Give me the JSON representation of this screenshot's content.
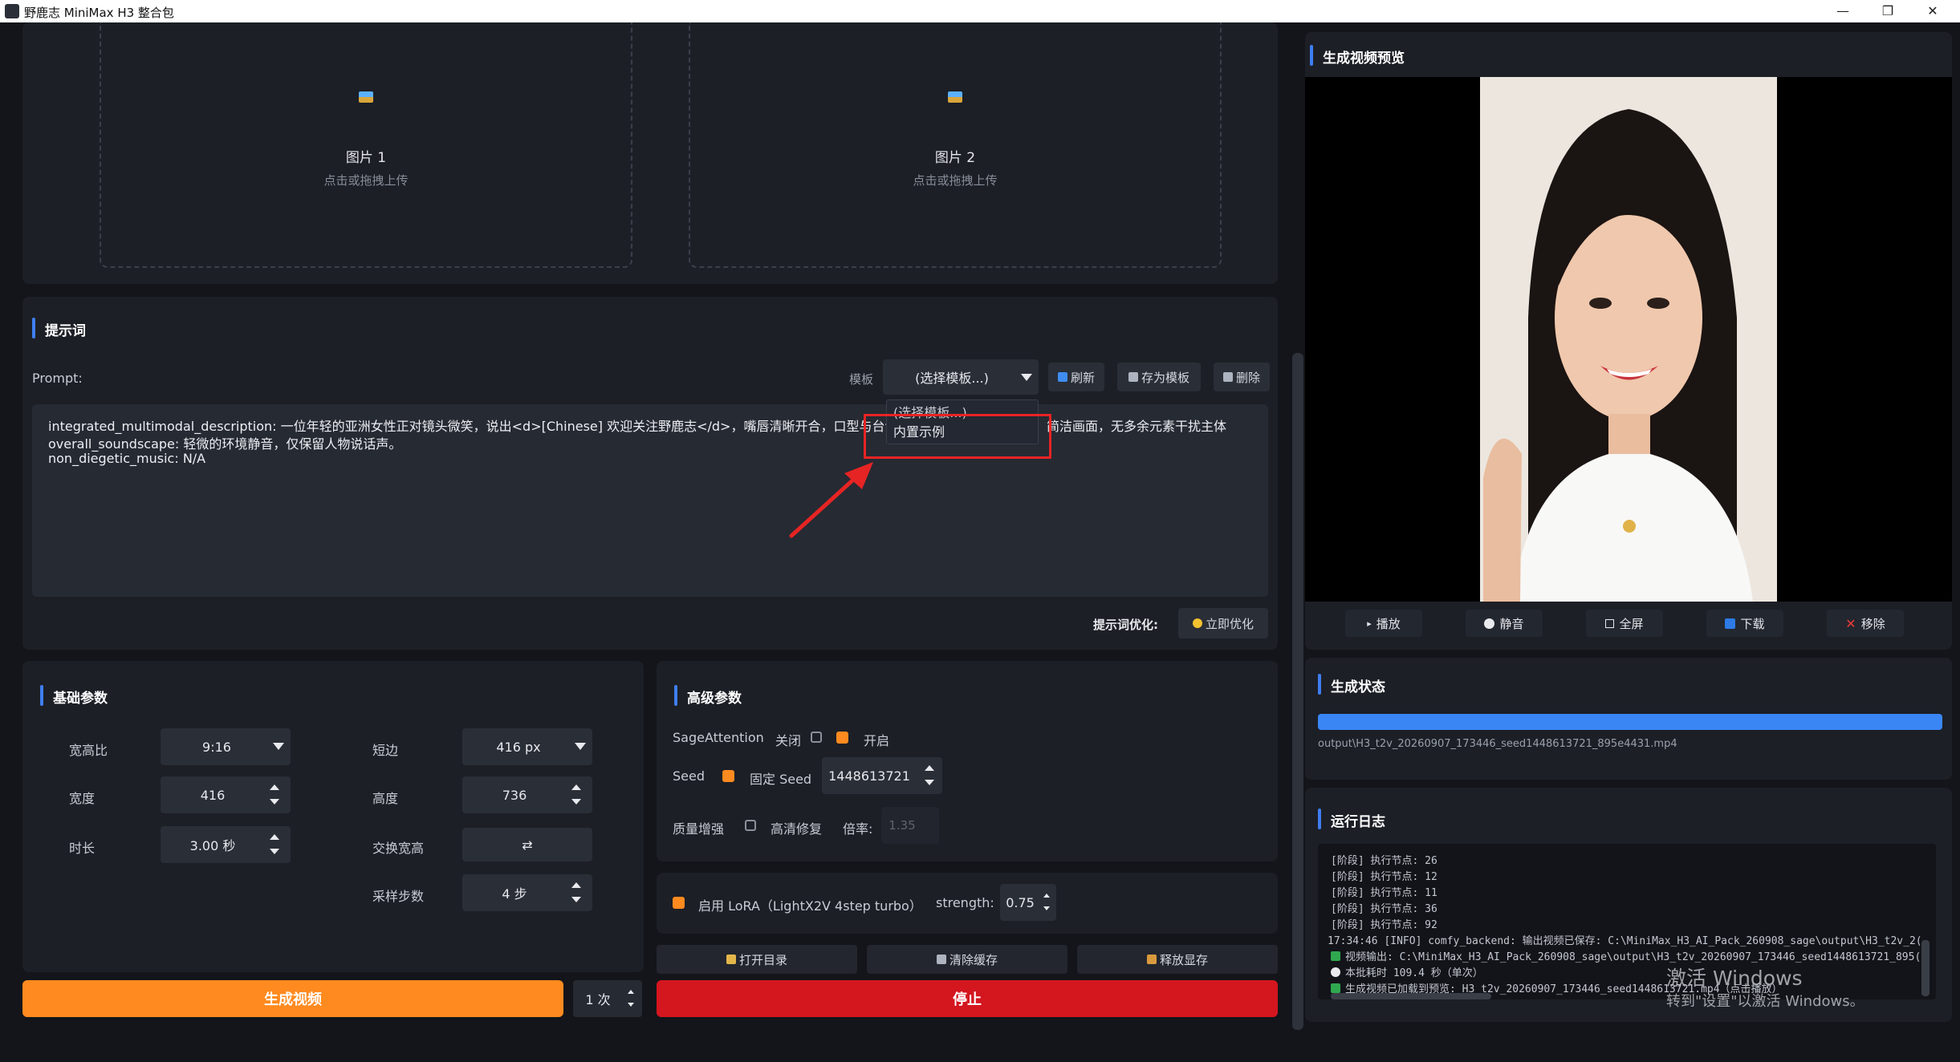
{
  "window": {
    "title": "野鹿志 MiniMax H3 整合包",
    "controls": [
      "—",
      "❐",
      "✕"
    ]
  },
  "upload": {
    "image1_label": "图片 1",
    "image2_label": "图片 2",
    "hint": "点击或拖拽上传"
  },
  "prompt_section": {
    "title": "提示词",
    "prompt_label": "Prompt:",
    "template_label": "模板",
    "template_selected": "(选择模板...)",
    "refresh": "刷新",
    "save_template": "存为模板",
    "delete": "删除",
    "lines": [
      "integrated_multimodal_description: 一位年轻的亚洲女性正对镜头微笑，说出<d>[Chinese] 欢迎关注野鹿志</d>，嘴唇清晰开合，口型与台词同",
      "overall_soundscape: 轻微的环境静音，仅保留人物说话声。",
      "non_diegetic_music: N/A"
    ],
    "line1_tail": "简洁画面，无多余元素干扰主体",
    "dropdown_items": [
      "(选择模板...)",
      "内置示例"
    ],
    "optimize_label": "提示词优化:",
    "optimize_button": "立即优化"
  },
  "basic": {
    "title": "基础参数",
    "aspect_label": "宽高比",
    "aspect_value": "9:16",
    "short_label": "短边",
    "short_value": "416 px",
    "width_label": "宽度",
    "width_value": "416",
    "height_label": "高度",
    "height_value": "736",
    "duration_label": "时长",
    "duration_value": "3.00 秒",
    "swap_label": "交换宽高",
    "swap_icon": "⇄",
    "steps_label": "采样步数",
    "steps_value": "4 步"
  },
  "advanced": {
    "title": "高级参数",
    "sage_label": "SageAttention",
    "sage_off": "关闭",
    "sage_on": "开启",
    "seed_label": "Seed",
    "fixed_seed": "固定 Seed",
    "seed_value": "1448613721",
    "quality_label": "质量增强",
    "hires_label": "高清修复",
    "ratio_label": "倍率:",
    "ratio_value": "1.35",
    "lora_label": "启用 LoRA（LightX2V 4step turbo）",
    "strength_label": "strength:",
    "strength_value": "0.75"
  },
  "actions": {
    "open_dir": "打开目录",
    "clear_cache": "清除缓存",
    "free_vram": "释放显存",
    "generate": "生成视频",
    "count": "1 次",
    "stop": "停止"
  },
  "preview": {
    "title": "生成视频预览",
    "play": "播放",
    "mute": "静音",
    "fullscreen": "全屏",
    "download": "下载",
    "remove": "移除"
  },
  "status": {
    "title": "生成状态",
    "progress": 1.0,
    "file": "output\\H3_t2v_20260907_173446_seed1448613721_895e4431.mp4"
  },
  "log": {
    "title": "运行日志",
    "lines": [
      "[阶段] 执行节点: 26",
      "[阶段] 执行节点: 12",
      "[阶段] 执行节点: 11",
      "[阶段] 执行节点: 36",
      "[阶段] 执行节点: 92",
      "17:34:46 [INFO] comfy_backend: 输出视频已保存: C:\\MiniMax_H3_AI_Pack_260908_sage\\output\\H3_t2v_2(",
      "视频输出: C:\\MiniMax_H3_AI_Pack_260908_sage\\output\\H3_t2v_20260907_173446_seed1448613721_895(",
      "本批耗时 109.4 秒（单次）",
      "生成视频已加载到预览: H3_t2v_20260907_173446_seed1448613721.mp4（点击播放）"
    ]
  },
  "watermark": {
    "line1": "激活 Windows",
    "line2": "转到\"设置\"以激活 Windows。"
  },
  "colors": {
    "accent_blue": "#3f7ef0",
    "generate_orange": "#ff8a1f",
    "stop_red": "#d4161f",
    "highlight_red": "#e62424"
  }
}
